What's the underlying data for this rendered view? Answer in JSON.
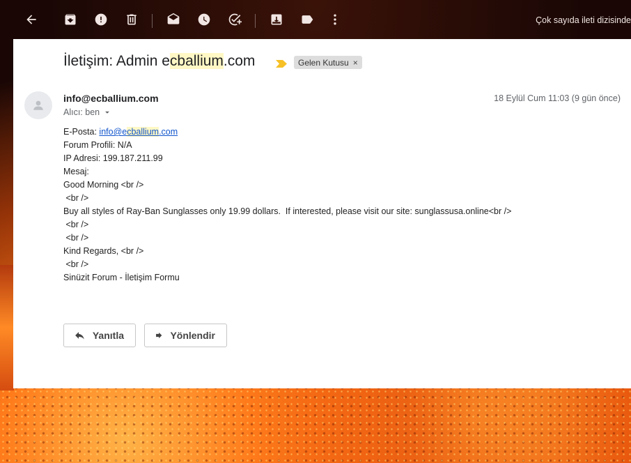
{
  "toolbar": {
    "icons": [
      "back-arrow-icon",
      "archive-icon",
      "report-spam-icon",
      "delete-icon",
      "mark-unread-icon",
      "snooze-icon",
      "add-task-icon",
      "move-to-icon",
      "label-icon",
      "more-icon"
    ],
    "right_text": "Çok sayıda ileti dizisinde"
  },
  "email": {
    "subject_prefix": "İletişim: Admin e",
    "subject_highlight": "cballium",
    "subject_suffix": ".com",
    "label": "Gelen Kutusu",
    "label_close": "×",
    "sender": "info@ecballium.com",
    "date": "18 Eylül Cum 11:03 (9 gün önce)",
    "recipient": "Alıcı: ben",
    "email_prefix": "E-Posta: ",
    "email_link_a": "info@e",
    "email_link_hl": "cballium",
    "email_link_b": ".com",
    "lines": [
      "Forum Profili: N/A",
      "IP Adresi: 199.187.211.99",
      "Mesaj:",
      "Good Morning <br />",
      " <br />",
      "Buy all styles of Ray-Ban Sunglasses only 19.99 dollars.  If interested, please visit our site: sunglassusa.online<br />",
      " <br />",
      " <br />",
      "Kind Regards, <br />",
      " <br />",
      "Sinüzit Forum - İletişim Formu"
    ]
  },
  "actions": {
    "reply_label": "Yanıtla",
    "forward_label": "Yönlendir"
  }
}
